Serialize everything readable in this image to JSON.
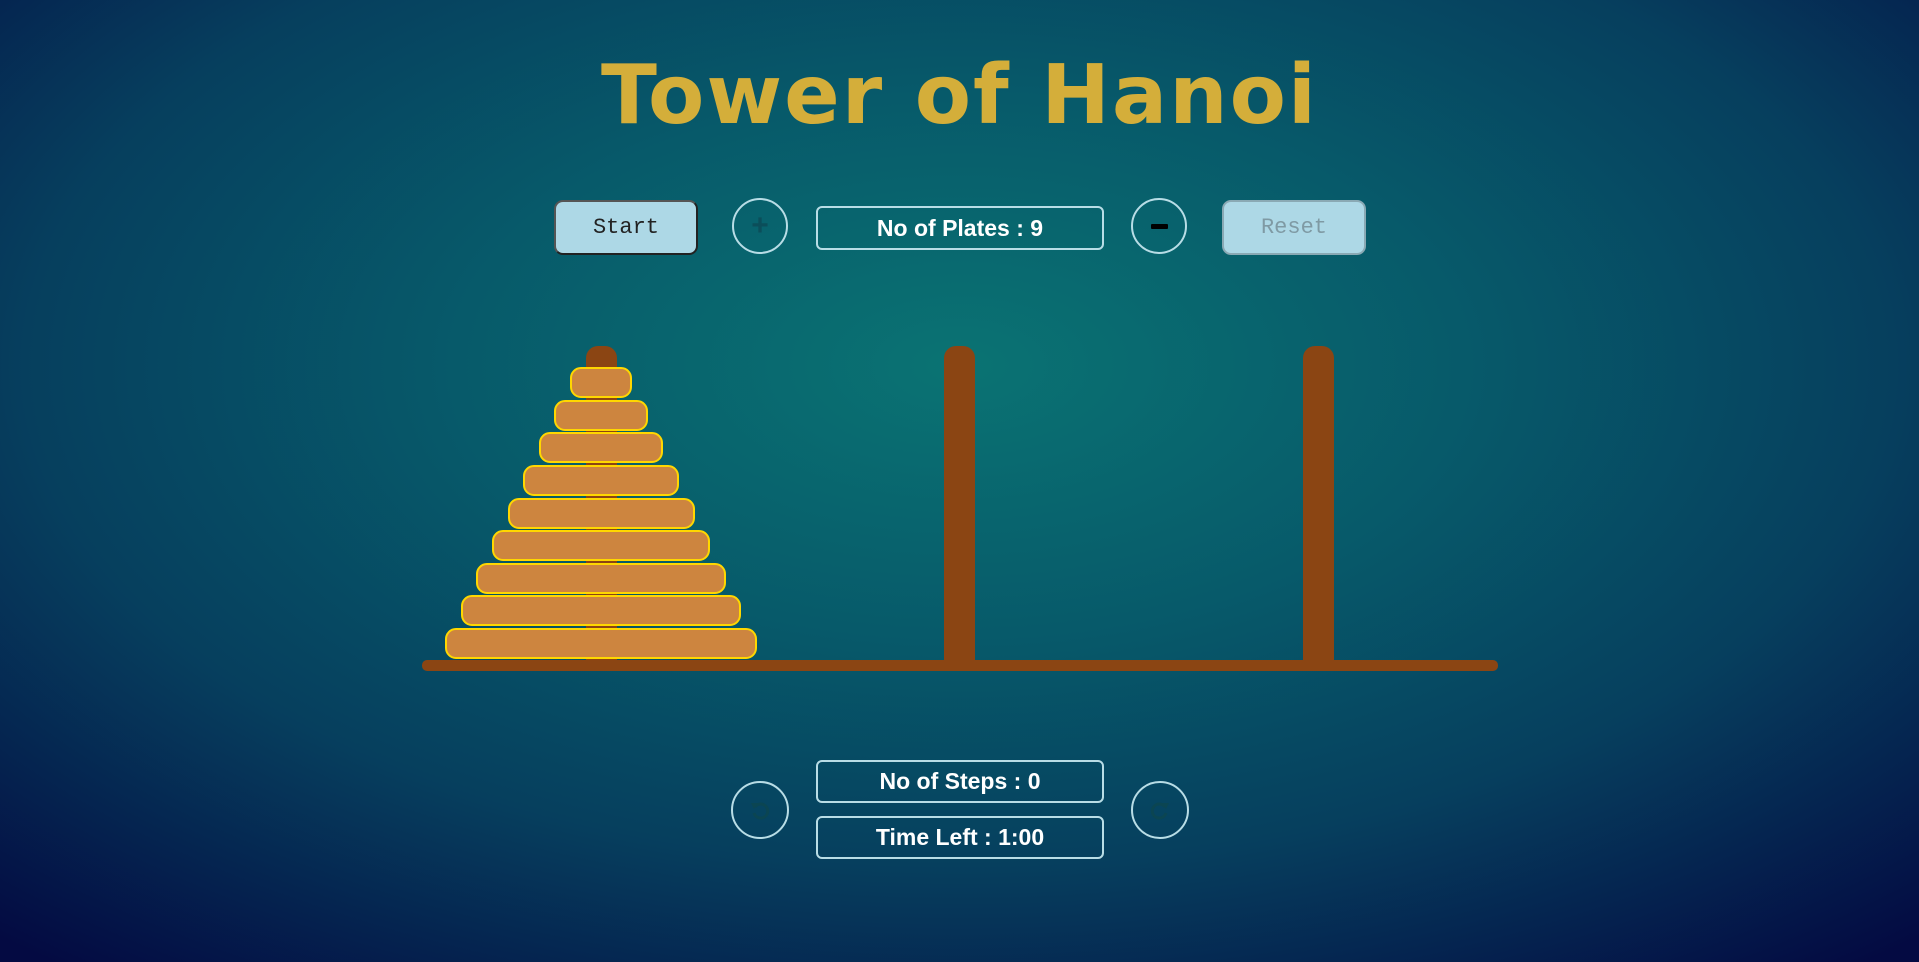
{
  "title": "Tower of Hanoi",
  "controls": {
    "start_label": "Start",
    "reset_label": "Reset",
    "plates_label": "No of Plates : 9",
    "plates": 9
  },
  "status": {
    "steps_label": "No of Steps : 0",
    "time_label": "Time Left : 1:00"
  },
  "icons": {
    "add": "plus-icon",
    "remove": "minus-icon",
    "undo": "undo-icon",
    "redo": "redo-icon"
  },
  "colors": {
    "title": "#d4ae3a",
    "disk": "#cd853f",
    "disk_border": "#ffd700",
    "peg": "#8b4513"
  },
  "pegs": [
    {
      "disks": [
        1,
        2,
        3,
        4,
        5,
        6,
        7,
        8,
        9
      ]
    },
    {
      "disks": []
    },
    {
      "disks": []
    }
  ]
}
